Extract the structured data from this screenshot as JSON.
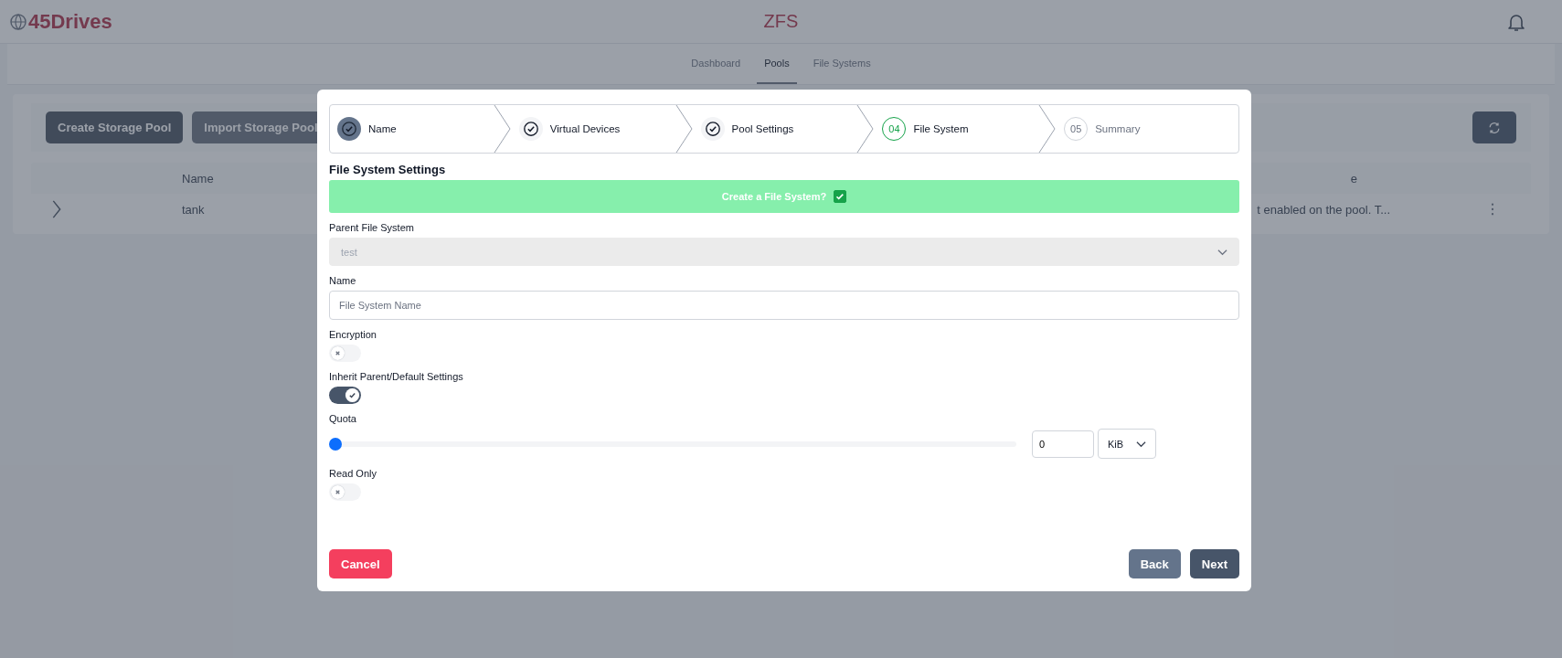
{
  "header": {
    "logo": "45Drives",
    "title": "ZFS"
  },
  "nav_tabs": [
    {
      "label": "Dashboard",
      "selected": false
    },
    {
      "label": "Pools",
      "selected": true
    },
    {
      "label": "File Systems",
      "selected": false
    }
  ],
  "pool_toolbar": {
    "buttons": [
      "Create Storage Pool",
      "Import Storage Pool"
    ]
  },
  "pool_table": {
    "columns": [
      "Name",
      "e"
    ],
    "rows": [
      {
        "name": "tank",
        "column_2": "t enabled on the pool. T..."
      }
    ]
  },
  "dialog": {
    "steps": [
      {
        "label": "Name",
        "completed": true,
        "active": false,
        "focused": true
      },
      {
        "label": "Virtual Devices",
        "completed": true,
        "active": false,
        "focused": false
      },
      {
        "label": "Pool Settings",
        "completed": true,
        "active": false,
        "focused": false
      },
      {
        "number": "04",
        "label": "File System",
        "completed": false,
        "active": true,
        "focused": false
      },
      {
        "number": "05",
        "label": "Summary",
        "completed": false,
        "active": false,
        "focused": false
      }
    ],
    "section_title": "File System Settings",
    "create_banner": {
      "label": "Create a File System?",
      "checked": true
    },
    "parent_file_system": {
      "label": "Parent File System",
      "value": "test",
      "disabled": true
    },
    "name": {
      "label": "Name",
      "placeholder": "File System Name"
    },
    "encryption": {
      "label": "Encryption",
      "on": false
    },
    "inherit": {
      "label": "Inherit Parent/Default Settings",
      "on": true
    },
    "quota": {
      "label": "Quota",
      "level": 0,
      "value": "0",
      "unit": "KiB"
    },
    "read_only": {
      "label": "Read Only",
      "on": false
    },
    "buttons": {
      "cancel": "Cancel",
      "back": "Back",
      "next": "Next"
    }
  }
}
